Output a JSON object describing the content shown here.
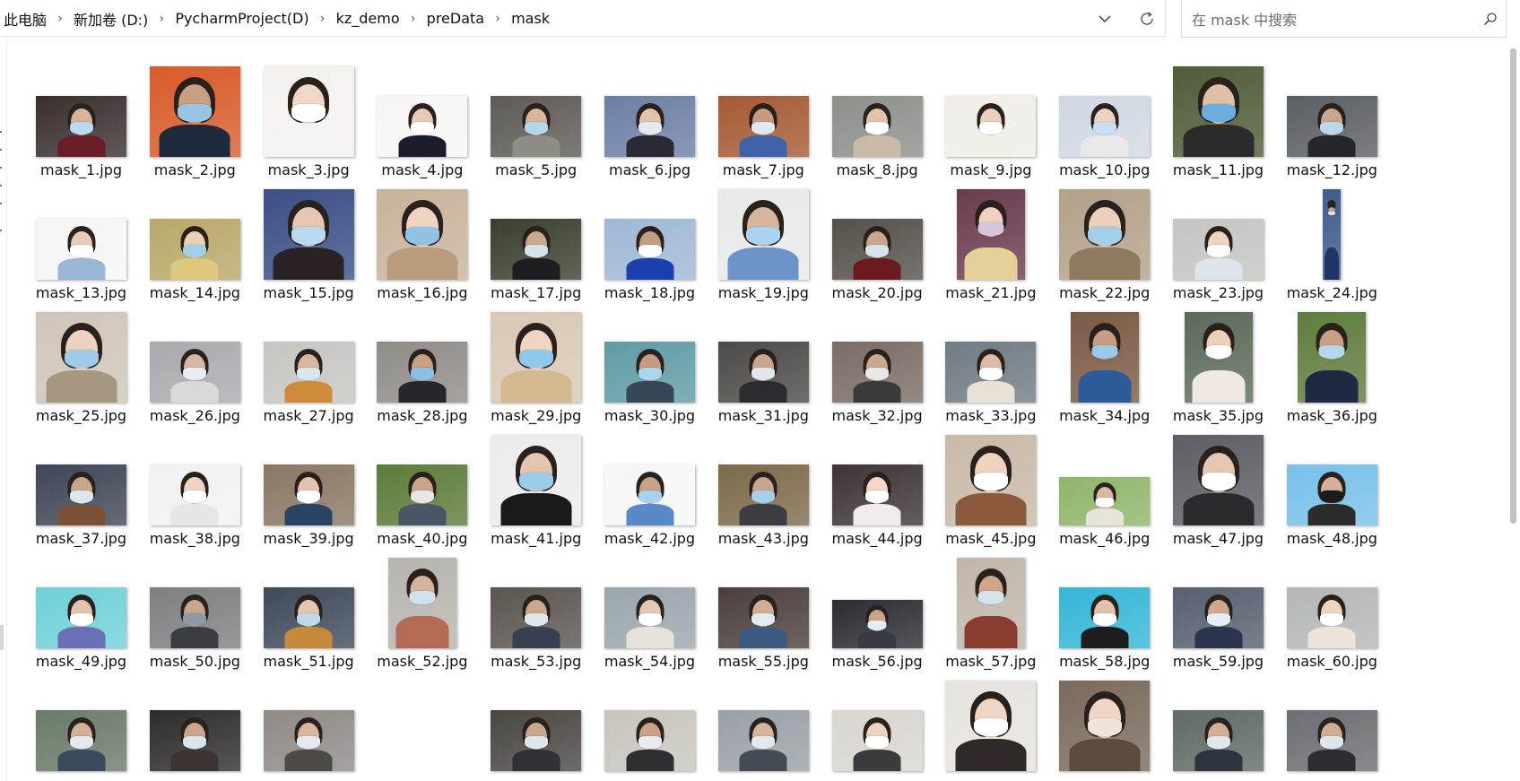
{
  "breadcrumb": [
    "此电脑",
    "新加卷 (D:)",
    "PycharmProject(D)",
    "kz_demo",
    "preData",
    "mask"
  ],
  "search": {
    "placeholder": "在 mask 中搜索"
  },
  "icons": {
    "separator": "chevron-right-icon",
    "dropdown": "chevron-down-icon",
    "refresh": "refresh-icon",
    "search": "search-icon"
  },
  "files": [
    {
      "name": "mask_1.jpg",
      "shape": "landscape",
      "bg": "#3a2f2f",
      "skin": "#d8b49a",
      "shirt": "#6a1e28",
      "mask": "#bcd9ee"
    },
    {
      "name": "mask_2.jpg",
      "shape": "square",
      "bg": "#d85b2a",
      "skin": "#c9a084",
      "shirt": "#1f2a3d",
      "mask": "#9ac4e6"
    },
    {
      "name": "mask_3.jpg",
      "shape": "square",
      "bg": "#f4f1ee",
      "skin": "#f0d7c6",
      "shirt": "#f4f4f4",
      "mask": "#ffffff"
    },
    {
      "name": "mask_4.jpg",
      "shape": "landscape",
      "bg": "#f7f6f5",
      "skin": "#e8c9b3",
      "shirt": "#1b1c2d",
      "mask": "#ffffff"
    },
    {
      "name": "mask_5.jpg",
      "shape": "landscape",
      "bg": "#5e5a55",
      "skin": "#d9b59e",
      "shirt": "#8e8e86",
      "mask": "#b7d6ea"
    },
    {
      "name": "mask_6.jpg",
      "shape": "landscape",
      "bg": "#6c7fa4",
      "skin": "#e0c2ad",
      "shirt": "#2a2a35",
      "mask": "#e6e9ee"
    },
    {
      "name": "mask_7.jpg",
      "shape": "landscape",
      "bg": "#a55a33",
      "skin": "#c69b80",
      "shirt": "#3e63a8",
      "mask": "#dfe8ef"
    },
    {
      "name": "mask_8.jpg",
      "shape": "landscape",
      "bg": "#8c8f8a",
      "skin": "#e2c3ad",
      "shirt": "#c9b9a6",
      "mask": "#ffffff"
    },
    {
      "name": "mask_9.jpg",
      "shape": "landscape",
      "bg": "#f1ede8",
      "skin": "#ead0bd",
      "shirt": "#f2efe9",
      "mask": "#ffffff"
    },
    {
      "name": "mask_10.jpg",
      "shape": "landscape",
      "bg": "#cfd8e2",
      "skin": "#ecd2c0",
      "shirt": "#e9e7ea",
      "mask": "#c6dff1"
    },
    {
      "name": "mask_11.jpg",
      "shape": "square",
      "bg": "#4f5c38",
      "skin": "#e0bfa6",
      "shirt": "#2b2b2b",
      "mask": "#6aaee0"
    },
    {
      "name": "mask_12.jpg",
      "shape": "landscape",
      "bg": "#5a5f63",
      "skin": "#c8a78f",
      "shirt": "#24262c",
      "mask": "#bcd6ea"
    },
    {
      "name": "mask_13.jpg",
      "shape": "landscape",
      "bg": "#f6f6f6",
      "skin": "#e8cbb6",
      "shirt": "#9cb6d8",
      "mask": "#ffffff"
    },
    {
      "name": "mask_14.jpg",
      "shape": "landscape",
      "bg": "#b9a86a",
      "skin": "#ecd2b4",
      "shirt": "#e0c77e",
      "mask": "#9fd2ea"
    },
    {
      "name": "mask_15.jpg",
      "shape": "square",
      "bg": "#3a4f86",
      "skin": "#e6c7b2",
      "shirt": "#2a2224",
      "mask": "#b8d9ee"
    },
    {
      "name": "mask_16.jpg",
      "shape": "square",
      "bg": "#c8b39b",
      "skin": "#f0d4c0",
      "shirt": "#b99c7e",
      "mask": "#8ec3e2"
    },
    {
      "name": "mask_17.jpg",
      "shape": "landscape",
      "bg": "#3b3f2d",
      "skin": "#c9a98f",
      "shirt": "#1e1e22",
      "mask": "#d6e2ea"
    },
    {
      "name": "mask_18.jpg",
      "shape": "landscape",
      "bg": "#9fb8d4",
      "skin": "#c49c80",
      "shirt": "#1c3fb0",
      "mask": "#ffffff"
    },
    {
      "name": "mask_19.jpg",
      "shape": "square",
      "bg": "#e9e9e9",
      "skin": "#d6b59d",
      "shirt": "#6e93c9",
      "mask": "#a9d3ee"
    },
    {
      "name": "mask_20.jpg",
      "shape": "landscape",
      "bg": "#55504a",
      "skin": "#c9a68e",
      "shirt": "#6b1a20",
      "mask": "#d5e3ec"
    },
    {
      "name": "mask_21.jpg",
      "shape": "portrait",
      "bg": "#6a3b4e",
      "skin": "#efd1be",
      "shirt": "#e6d09a",
      "mask": "#d7c4dd"
    },
    {
      "name": "mask_22.jpg",
      "shape": "square",
      "bg": "#b3a189",
      "skin": "#ecd0bb",
      "shirt": "#8f7a5f",
      "mask": "#a3cfe8"
    },
    {
      "name": "mask_23.jpg",
      "shape": "landscape",
      "bg": "#c6c4c0",
      "skin": "#efd4c2",
      "shirt": "#dfe4ea",
      "mask": "#ffffff"
    },
    {
      "name": "mask_24.jpg",
      "shape": "narrow",
      "bg": "#3d5b8c",
      "skin": "#cba68c",
      "shirt": "#1e3566",
      "mask": "#d7e6f1"
    },
    {
      "name": "mask_25.jpg",
      "shape": "square",
      "bg": "#cfc6ba",
      "skin": "#eed2bf",
      "shirt": "#a6977f",
      "mask": "#9fcbe6"
    },
    {
      "name": "mask_26.jpg",
      "shape": "landscape",
      "bg": "#a9aaae",
      "skin": "#d6b8a3",
      "shirt": "#d9d9d9",
      "mask": "#e6eef3"
    },
    {
      "name": "mask_27.jpg",
      "shape": "landscape",
      "bg": "#c7c5c1",
      "skin": "#d8b7a0",
      "shirt": "#d08a3c",
      "mask": "#dbe7ef"
    },
    {
      "name": "mask_28.jpg",
      "shape": "landscape",
      "bg": "#8f8c88",
      "skin": "#c8a085",
      "shirt": "#25272c",
      "mask": "#88c0e6"
    },
    {
      "name": "mask_29.jpg",
      "shape": "square",
      "bg": "#d9c8b5",
      "skin": "#f0d5c2",
      "shirt": "#d4b88f",
      "mask": "#8ec8ea"
    },
    {
      "name": "mask_30.jpg",
      "shape": "landscape",
      "bg": "#5f9ca6",
      "skin": "#c59c80",
      "shirt": "#374756",
      "mask": "#a9d7ee"
    },
    {
      "name": "mask_31.jpg",
      "shape": "landscape",
      "bg": "#4c4a47",
      "skin": "#cba78f",
      "shirt": "#2b2b30",
      "mask": "#dfe7ec"
    },
    {
      "name": "mask_32.jpg",
      "shape": "landscape",
      "bg": "#7a6c64",
      "skin": "#caa78d",
      "shirt": "#3a3a3a",
      "mask": "#e8e8e8"
    },
    {
      "name": "mask_33.jpg",
      "shape": "landscape",
      "bg": "#6f7c82",
      "skin": "#dcbca6",
      "shirt": "#e8e2d6",
      "mask": "#ffffff"
    },
    {
      "name": "mask_34.jpg",
      "shape": "portrait",
      "bg": "#7b5a44",
      "skin": "#c69d82",
      "shirt": "#2c5b9a",
      "mask": "#9dc9e8"
    },
    {
      "name": "mask_35.jpg",
      "shape": "portrait",
      "bg": "#5b6a5a",
      "skin": "#ecd0bb",
      "shirt": "#efe9e0",
      "mask": "#ffffff"
    },
    {
      "name": "mask_36.jpg",
      "shape": "portrait",
      "bg": "#5f7c3e",
      "skin": "#c9a085",
      "shirt": "#1e2a44",
      "mask": "#b6d6ea"
    },
    {
      "name": "mask_37.jpg",
      "shape": "landscape",
      "bg": "#3f4656",
      "skin": "#c9a58c",
      "shirt": "#7a5136",
      "mask": "#dce6ee"
    },
    {
      "name": "mask_38.jpg",
      "shape": "landscape",
      "bg": "#f1f1f2",
      "skin": "#eed3c1",
      "shirt": "#e6e6e8",
      "mask": "#ffffff"
    },
    {
      "name": "mask_39.jpg",
      "shape": "landscape",
      "bg": "#8a7764",
      "skin": "#e3c3ac",
      "shirt": "#2a4563",
      "mask": "#ffffff"
    },
    {
      "name": "mask_40.jpg",
      "shape": "landscape",
      "bg": "#5d7b3a",
      "skin": "#c9a58b",
      "shirt": "#4a5666",
      "mask": "#e6e6e6"
    },
    {
      "name": "mask_41.jpg",
      "shape": "square",
      "bg": "#ececec",
      "skin": "#e3c4ae",
      "shirt": "#1a1a1a",
      "mask": "#9bcdea"
    },
    {
      "name": "mask_42.jpg",
      "shape": "landscape",
      "bg": "#f7f7f7",
      "skin": "#c9a186",
      "shirt": "#5a89c8",
      "mask": "#a7d1ec"
    },
    {
      "name": "mask_43.jpg",
      "shape": "landscape",
      "bg": "#7d6a4a",
      "skin": "#c9a68c",
      "shirt": "#3d3c40",
      "mask": "#a6d0ea"
    },
    {
      "name": "mask_44.jpg",
      "shape": "landscape",
      "bg": "#3d3438",
      "skin": "#f0d7c7",
      "shirt": "#f0ece9",
      "mask": "#ffffff"
    },
    {
      "name": "mask_45.jpg",
      "shape": "square",
      "bg": "#c9b9a7",
      "skin": "#efd3bf",
      "shirt": "#8a5a3a",
      "mask": "#ffffff"
    },
    {
      "name": "mask_46.jpg",
      "shape": "wide",
      "bg": "#8fb56a",
      "skin": "#d8b8a1",
      "shirt": "#e9e4db",
      "mask": "#ffffff"
    },
    {
      "name": "mask_47.jpg",
      "shape": "square",
      "bg": "#5b5e63",
      "skin": "#e6c7b1",
      "shirt": "#2a2a2d",
      "mask": "#ffffff"
    },
    {
      "name": "mask_48.jpg",
      "shape": "landscape",
      "bg": "#78c0ea",
      "skin": "#d6b09a",
      "shirt": "#2b2b2b",
      "mask": "#1b1b1d"
    },
    {
      "name": "mask_49.jpg",
      "shape": "landscape",
      "bg": "#6fd0d8",
      "skin": "#e3c3ad",
      "shirt": "#6a6fb8",
      "mask": "#ffffff"
    },
    {
      "name": "mask_50.jpg",
      "shape": "landscape",
      "bg": "#7e7f81",
      "skin": "#c9a58b",
      "shirt": "#3a3d42",
      "mask": "#8e9aa6"
    },
    {
      "name": "mask_51.jpg",
      "shape": "landscape",
      "bg": "#3f4a5a",
      "skin": "#e4c6b2",
      "shirt": "#c7893a",
      "mask": "#bcd9ea"
    },
    {
      "name": "mask_52.jpg",
      "shape": "portrait",
      "bg": "#b7b4af",
      "skin": "#d6b39b",
      "shirt": "#b56a54",
      "mask": "#cfe1ec"
    },
    {
      "name": "mask_53.jpg",
      "shape": "landscape",
      "bg": "#5b5550",
      "skin": "#cba78e",
      "shirt": "#394052",
      "mask": "#dfe7ec"
    },
    {
      "name": "mask_54.jpg",
      "shape": "landscape",
      "bg": "#9aa6ad",
      "skin": "#e5c8b3",
      "shirt": "#e6e2da",
      "mask": "#ffffff"
    },
    {
      "name": "mask_55.jpg",
      "shape": "landscape",
      "bg": "#4a3f3c",
      "skin": "#d1ad93",
      "shirt": "#3d5a80",
      "mask": "#e2eaf0"
    },
    {
      "name": "mask_56.jpg",
      "shape": "wide",
      "bg": "#2b2c32",
      "skin": "#c9a58d",
      "shirt": "#3a3a44",
      "mask": "#e5eef4"
    },
    {
      "name": "mask_57.jpg",
      "shape": "portrait",
      "bg": "#c0b6ab",
      "skin": "#cfa68c",
      "shirt": "#8a3d2e",
      "mask": "#d5e3ec"
    },
    {
      "name": "mask_58.jpg",
      "shape": "landscape",
      "bg": "#34b6d6",
      "skin": "#e3c2ab",
      "shirt": "#1d1d1f",
      "mask": "#ffffff"
    },
    {
      "name": "mask_59.jpg",
      "shape": "landscape",
      "bg": "#576070",
      "skin": "#cda88f",
      "shirt": "#2c3550",
      "mask": "#e5eef4"
    },
    {
      "name": "mask_60.jpg",
      "shape": "landscape",
      "bg": "#b4b7b5",
      "skin": "#eed3c0",
      "shirt": "#ece4d8",
      "mask": "#ffffff"
    },
    {
      "name": "",
      "shape": "landscape",
      "bg": "#6a7a6a",
      "skin": "#d2b198",
      "shirt": "#3c4a5e",
      "mask": "#dfeaf1"
    },
    {
      "name": "",
      "shape": "landscape",
      "bg": "#2e2c2b",
      "skin": "#c9a58b",
      "shirt": "#3a3532",
      "mask": "#d9e4ec"
    },
    {
      "name": "",
      "shape": "landscape",
      "bg": "#8f8a86",
      "skin": "#d8b7a1",
      "shirt": "#4d4a48",
      "mask": "#e3ebf1"
    },
    {
      "name": "",
      "shape": "empty"
    },
    {
      "name": "",
      "shape": "landscape",
      "bg": "#4a4642",
      "skin": "#cba78e",
      "shirt": "#303136",
      "mask": "#dde6ec"
    },
    {
      "name": "",
      "shape": "landscape",
      "bg": "#c9c4be",
      "skin": "#c9a186",
      "shirt": "#2f2f33",
      "mask": "#e6eef4"
    },
    {
      "name": "",
      "shape": "landscape",
      "bg": "#9aa0a6",
      "skin": "#d6b49c",
      "shirt": "#444b55",
      "mask": "#e1e9ef"
    },
    {
      "name": "",
      "shape": "landscape",
      "bg": "#d9d6d1",
      "skin": "#eed3c1",
      "shirt": "#3b3b3e",
      "mask": "#ffffff"
    },
    {
      "name": "",
      "shape": "square",
      "bg": "#e7e3de",
      "skin": "#efd5c3",
      "shirt": "#2f2a28",
      "mask": "#ffffff"
    },
    {
      "name": "",
      "shape": "square",
      "bg": "#7a6a5c",
      "skin": "#f0d6c4",
      "shirt": "#5b4a3e",
      "mask": "#efe4da"
    },
    {
      "name": "",
      "shape": "landscape",
      "bg": "#5f6b64",
      "skin": "#d1ae95",
      "shirt": "#2e3540",
      "mask": "#dfe8ee"
    },
    {
      "name": "",
      "shape": "landscape",
      "bg": "#6b6e72",
      "skin": "#cfad94",
      "shirt": "#2b2d33",
      "mask": "#dde7ee"
    }
  ]
}
